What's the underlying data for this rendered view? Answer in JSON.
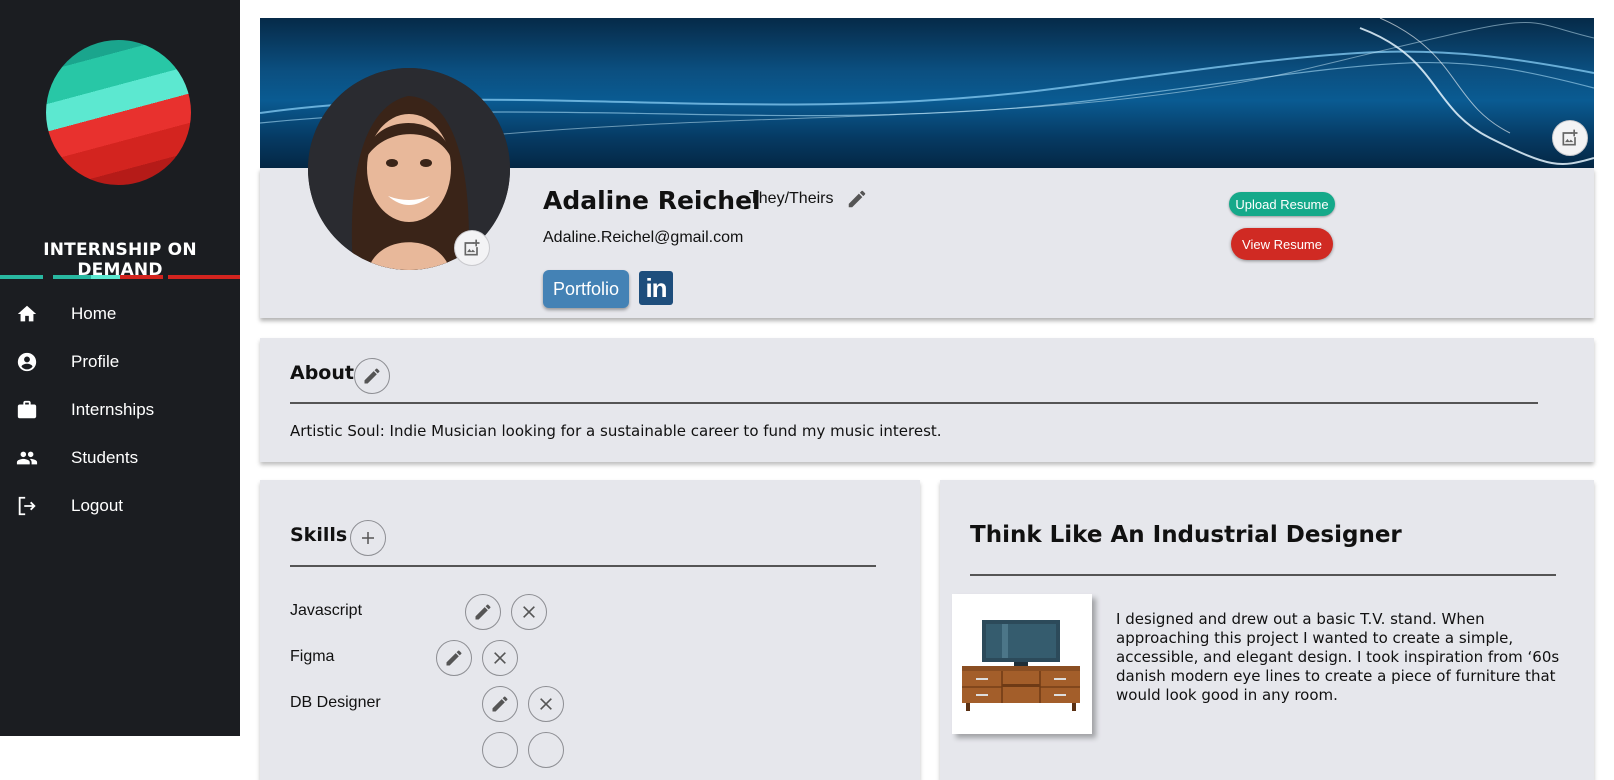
{
  "app": {
    "brand": "INTERNSHIP ON DEMAND"
  },
  "nav": [
    {
      "label": "Home",
      "icon": "home-icon"
    },
    {
      "label": "Profile",
      "icon": "account-circle-icon"
    },
    {
      "label": "Internships",
      "icon": "briefcase-icon"
    },
    {
      "label": "Students",
      "icon": "people-icon"
    },
    {
      "label": "Logout",
      "icon": "logout-icon"
    }
  ],
  "profile": {
    "name": "Adaline Reichel",
    "pronouns": "They/Theirs",
    "email": "Adaline.Reichel@gmail.com",
    "portfolio_label": "Portfolio",
    "linkedin_label": "in",
    "upload_resume_label": "Upload Resume",
    "view_resume_label": "View Resume"
  },
  "about": {
    "title": "About",
    "text": "Artistic Soul: Indie Musician looking for a sustainable career to fund my music interest."
  },
  "skills": {
    "title": "Skills",
    "items": [
      {
        "name": "Javascript"
      },
      {
        "name": "Figma"
      },
      {
        "name": "DB Designer"
      }
    ]
  },
  "project": {
    "title": "Think Like An Industrial Designer",
    "description": "I designed and drew out a basic T.V. stand. When approaching this project I wanted to create a simple, accessible, and elegant design. I took inspiration from ‘60s danish modern eye lines to create a piece of furniture that would look good in any room."
  },
  "colors": {
    "sidebar_bg": "#1b1d21",
    "card_bg": "#e6e7ec",
    "portfolio_blue": "#4482b5",
    "upload_green": "#15a98a",
    "view_red": "#d02a23",
    "linkedin_blue": "#1e4e7c"
  }
}
